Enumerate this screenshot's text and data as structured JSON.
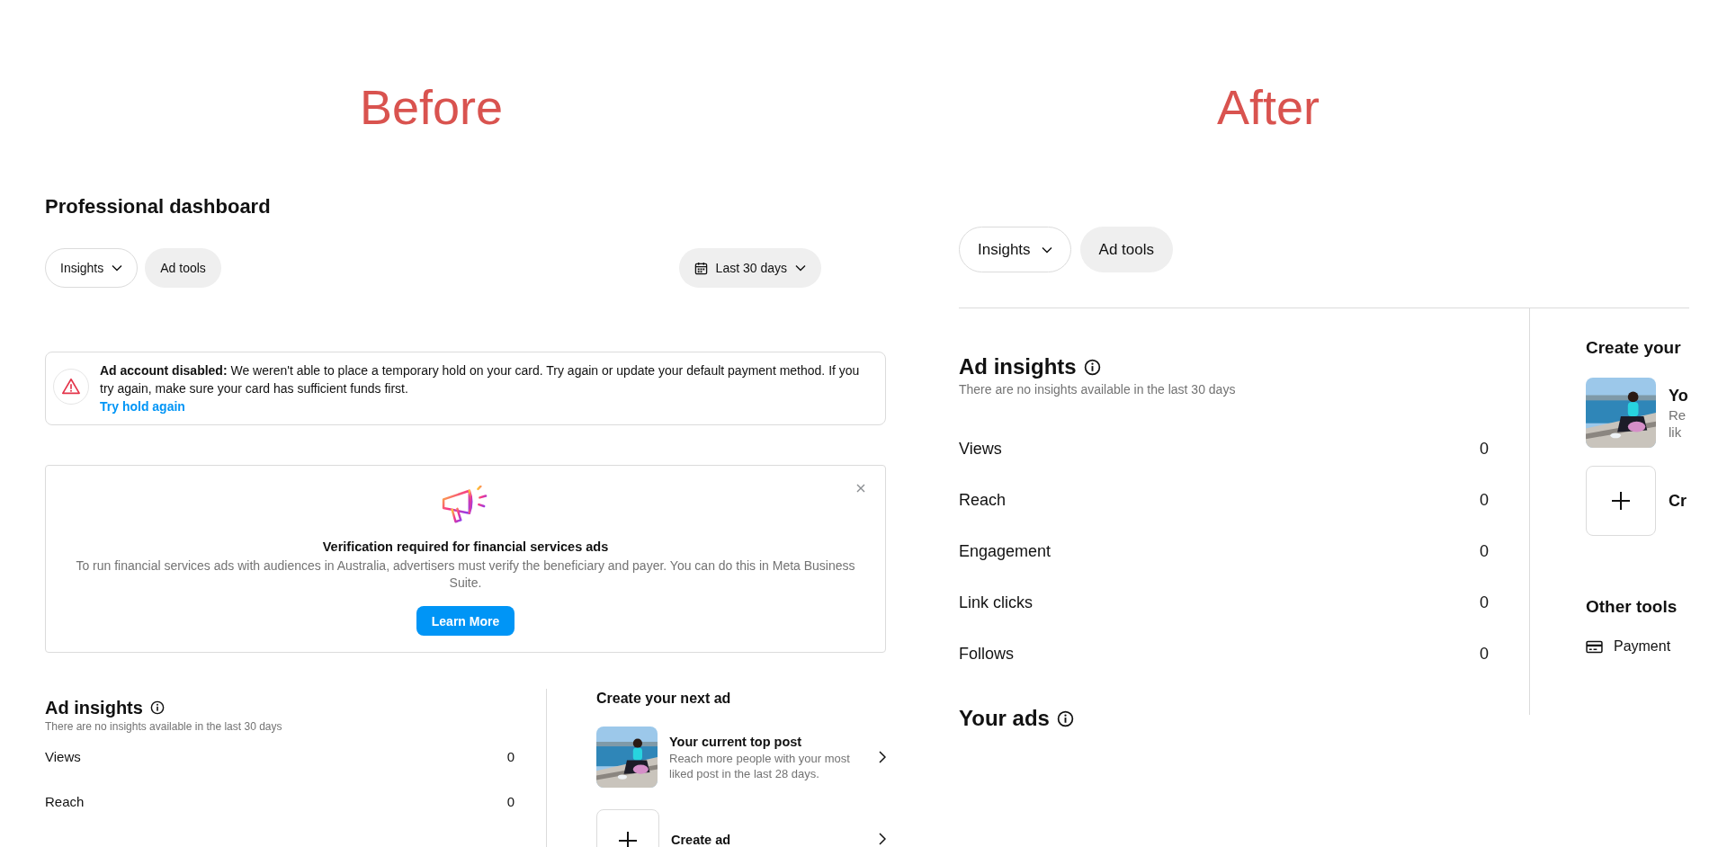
{
  "before": {
    "label": "Before",
    "title": "Professional dashboard",
    "tabs": [
      {
        "label": "Insights",
        "kind": "dropdown"
      },
      {
        "label": "Ad tools",
        "kind": "plain"
      }
    ],
    "date_range": "Last 30 days",
    "alert": {
      "message": "**Ad account disabled:** We weren't able to place a temporary hold on your card. Try again or update your default payment method. If you try again, make sure your card has sufficient funds first.",
      "link": "Try hold again"
    },
    "promo": {
      "title": "Verification required for financial services ads",
      "body": "To run financial services ads with audiences in Australia, advertisers must verify the beneficiary and payer. You can do this in Meta Business Suite.",
      "button": "Learn More"
    },
    "insights": {
      "title": "Ad insights",
      "subtitle": "There are no insights available in the last 30 days",
      "metrics": [
        {
          "label": "Views",
          "value": "0"
        },
        {
          "label": "Reach",
          "value": "0"
        }
      ]
    },
    "create": {
      "title": "Create your next ad",
      "items": [
        {
          "kind": "post",
          "title": "Your current top post",
          "description": "Reach more people with your most liked post in the last 28 days."
        },
        {
          "kind": "create",
          "title": "Create ad"
        }
      ]
    }
  },
  "after": {
    "label": "After",
    "tabs": [
      {
        "label": "Insights",
        "kind": "dropdown"
      },
      {
        "label": "Ad tools",
        "kind": "plain"
      }
    ],
    "insights": {
      "title": "Ad insights",
      "subtitle": "There are no insights available in the last 30 days",
      "metrics": [
        {
          "label": "Views",
          "value": "0"
        },
        {
          "label": "Reach",
          "value": "0"
        },
        {
          "label": "Engagement",
          "value": "0"
        },
        {
          "label": "Link clicks",
          "value": "0"
        },
        {
          "label": "Follows",
          "value": "0"
        }
      ]
    },
    "your_ads": "Your ads",
    "create": {
      "title": "Create your",
      "items": [
        {
          "kind": "post",
          "title": "Yo",
          "description_lines": [
            "Re",
            "lik"
          ]
        },
        {
          "kind": "create",
          "title": "Cr"
        }
      ]
    },
    "other_tools": {
      "title": "Other tools",
      "items": [
        {
          "label": "Payment"
        }
      ]
    }
  }
}
